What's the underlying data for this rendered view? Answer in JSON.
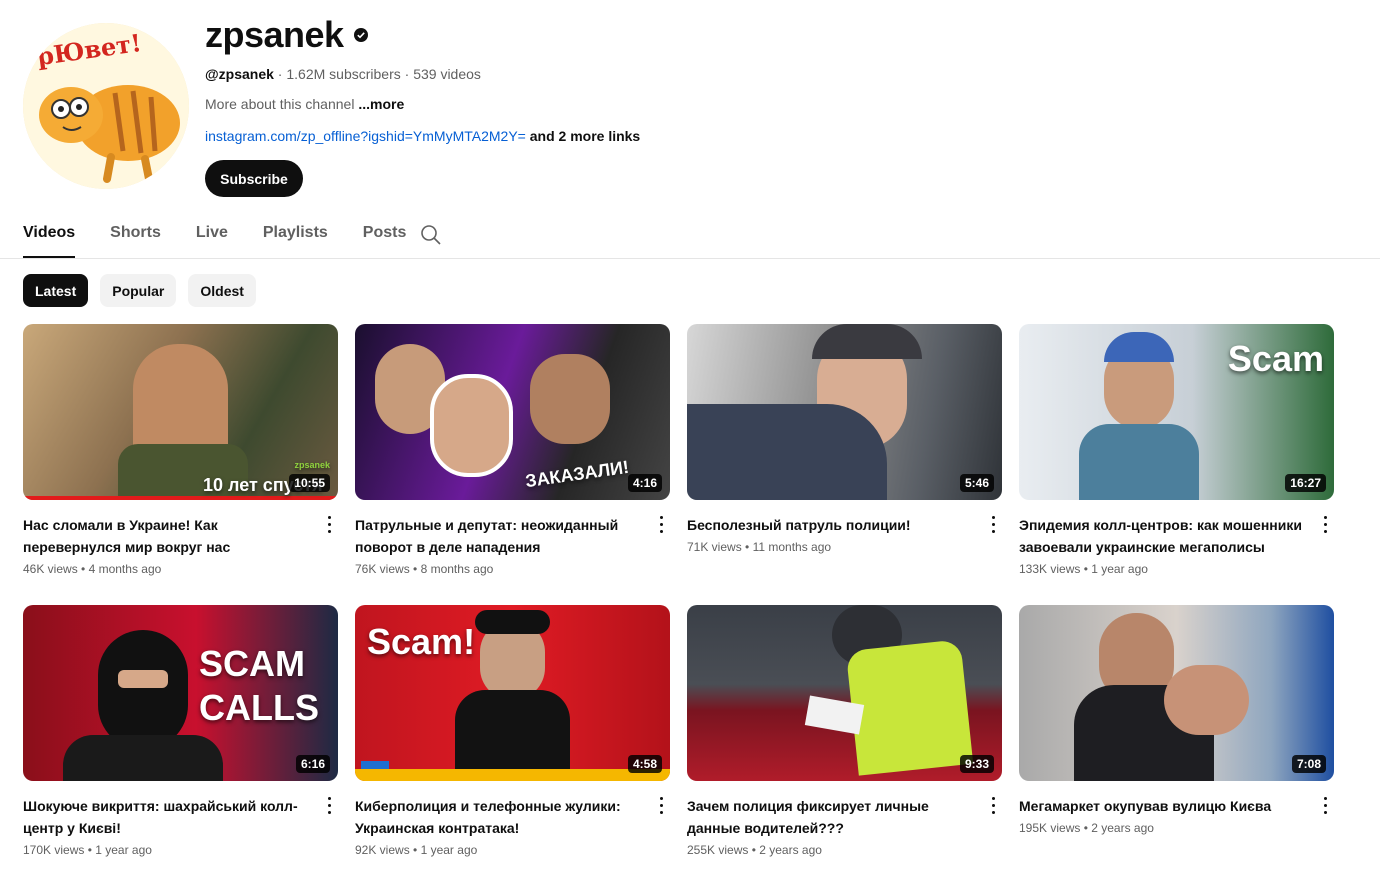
{
  "channel": {
    "name": "zpsanek",
    "handle": "@zpsanek",
    "subscribers": "1.62M subscribers",
    "videos_count": "539 videos",
    "about": "More about this channel",
    "about_more": "...more",
    "link": "instagram.com/zp_offline?igshid=YmMyMTA2M2Y=",
    "more_links": "and 2 more links",
    "subscribe_label": "Subscribe",
    "avatar_text": "рЮвет!"
  },
  "tabs": [
    "Videos",
    "Shorts",
    "Live",
    "Playlists",
    "Posts"
  ],
  "chips": [
    "Latest",
    "Popular",
    "Oldest"
  ],
  "videos": [
    {
      "title": "Нас сломали в Украине! Как перевернулся мир вокруг нас",
      "views": "46K views",
      "age": "4 months ago",
      "duration": "10:55",
      "overlay": "10 лет спустя",
      "badge": "zpsanek"
    },
    {
      "title": "Патрульные и депутат: неожиданный поворот в деле нападения",
      "views": "76K views",
      "age": "8 months ago",
      "duration": "4:16",
      "overlay": "ЗАКАЗАЛИ!"
    },
    {
      "title": "Бесполезный патруль полиции!",
      "views": "71K views",
      "age": "11 months ago",
      "duration": "5:46"
    },
    {
      "title": "Эпидемия колл-центров: как мошенники завоевали украинские мегаполисы",
      "views": "133K views",
      "age": "1 year ago",
      "duration": "16:27",
      "overlay": "Scam"
    },
    {
      "title": "Шокуюче викриття: шахрайський колл-центр у Києві!",
      "views": "170K views",
      "age": "1 year ago",
      "duration": "6:16",
      "overlay": "SCAM",
      "overlay2": "CALLS"
    },
    {
      "title": "Киберполиция и телефонные жулики: Украинская контратака!",
      "views": "92K views",
      "age": "1 year ago",
      "duration": "4:58",
      "overlay": "Scam!"
    },
    {
      "title": "Зачем полиция фиксирует личные данные водителей???",
      "views": "255K views",
      "age": "2 years ago",
      "duration": "9:33"
    },
    {
      "title": "Мегамаркет окупував вулицю Києва",
      "views": "195K views",
      "age": "2 years ago",
      "duration": "7:08"
    }
  ]
}
